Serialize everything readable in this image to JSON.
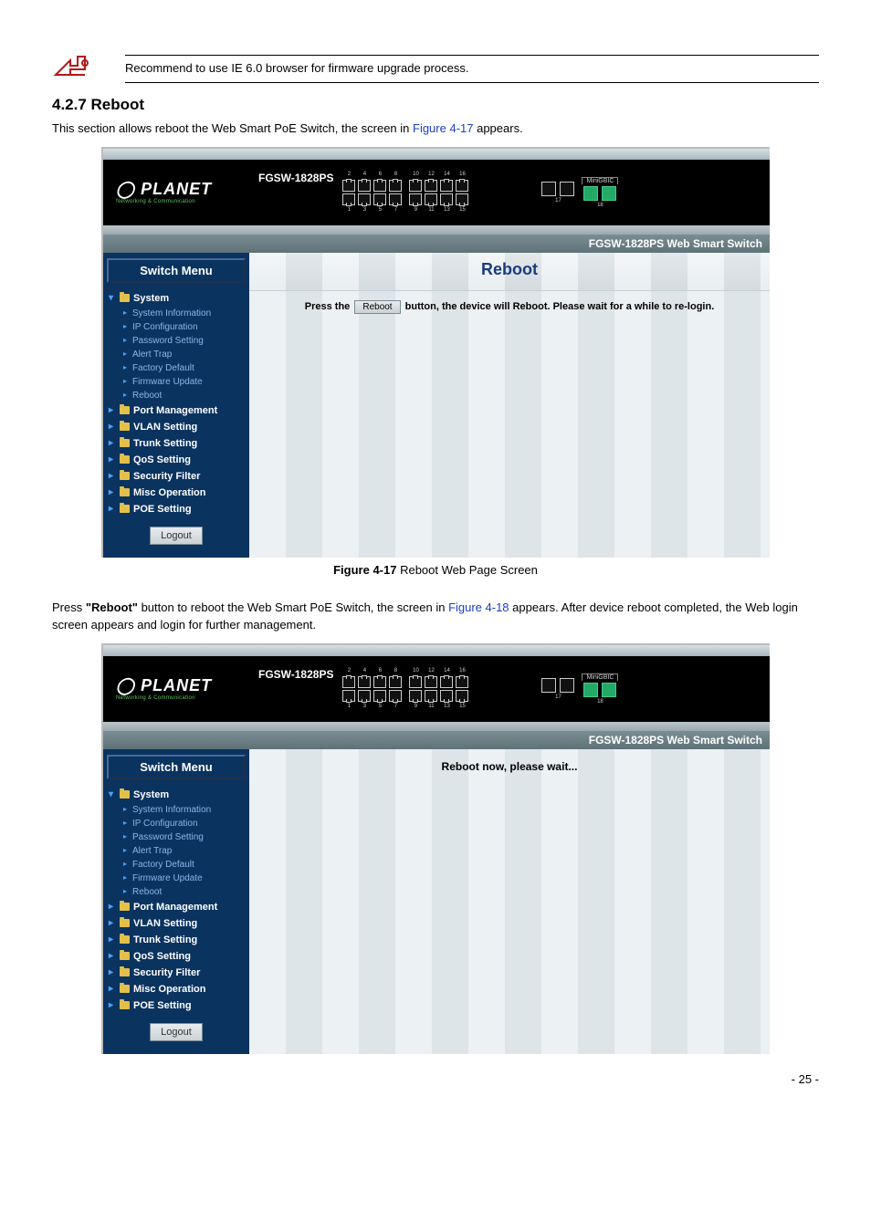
{
  "note": "Recommend to use IE 6.0 browser for firmware upgrade process.",
  "section_heading": "4.2.7 Reboot",
  "intro_text_prefix": "This section allows reboot the Web Smart PoE Switch, the screen in ",
  "intro_link": "Figure 4-17",
  "intro_text_suffix": " appears.",
  "figure1_caption_bold": "Figure 4-17",
  "figure1_caption_rest": " Reboot Web Page Screen",
  "para2_prefix": "Press ",
  "para2_bold": "\"Reboot\"",
  "para2_mid": " button to reboot the Web Smart PoE Switch, the screen in ",
  "para2_link": "Figure 4-18",
  "para2_suffix": " appears. After device reboot completed, the Web login screen appears and login for further management.",
  "page_number": "- 25 -",
  "device": {
    "model": "FGSW-1828PS",
    "brand_main": "PLANET",
    "brand_sub": "Networking & Communication",
    "gbic_label": "MiniGBIC",
    "port_top_numbers": [
      "2",
      "4",
      "6",
      "8",
      "10",
      "12",
      "14",
      "16"
    ],
    "port_bot_numbers": [
      "1",
      "3",
      "5",
      "7",
      "9",
      "11",
      "13",
      "15"
    ],
    "gbic_nums": [
      "17",
      "18"
    ],
    "right_title": "FGSW-1828PS Web Smart Switch"
  },
  "menu": {
    "switch_menu": "Switch Menu",
    "system": "System",
    "items": [
      "System Information",
      "IP Configuration",
      "Password Setting",
      "Alert Trap",
      "Factory Default",
      "Firmware Update",
      "Reboot"
    ],
    "folders": [
      "Port Management",
      "VLAN Setting",
      "Trunk Setting",
      "QoS Setting",
      "Security Filter",
      "Misc Operation",
      "POE Setting"
    ],
    "logout": "Logout"
  },
  "content1": {
    "heading": "Reboot",
    "line_prefix": "Press the ",
    "button_label": "Reboot",
    "line_suffix": " button, the device will Reboot.  Please wait for a while to re-login."
  },
  "content2": {
    "wait_text": "Reboot now, please wait..."
  }
}
